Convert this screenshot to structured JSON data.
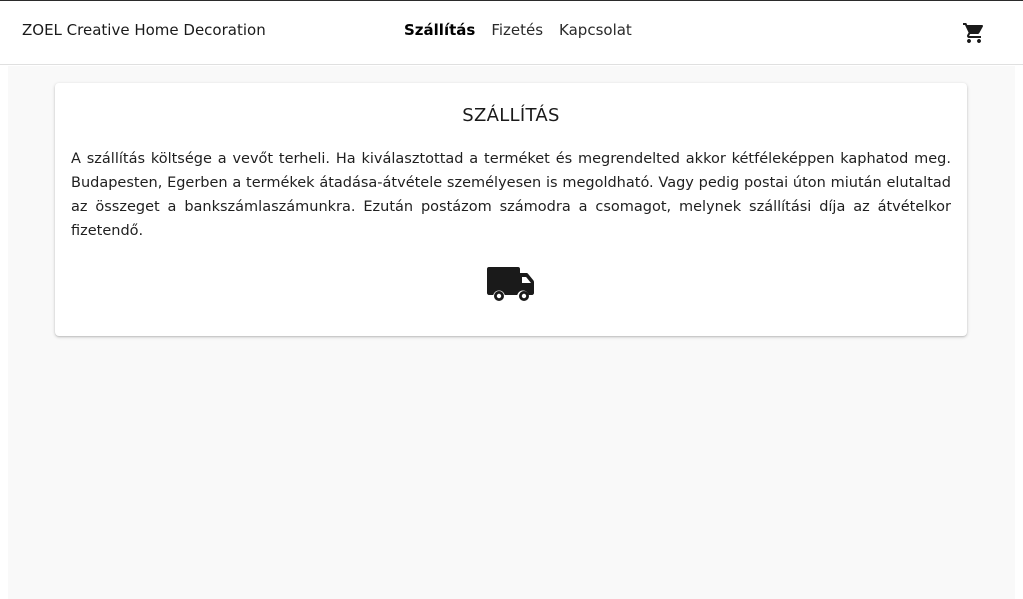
{
  "header": {
    "brand": "ZOEL Creative Home Decoration",
    "nav": [
      {
        "label": "Szállítás",
        "active": true
      },
      {
        "label": "Fizetés",
        "active": false
      },
      {
        "label": "Kapcsolat",
        "active": false
      }
    ],
    "cart_icon": "shopping-cart-icon"
  },
  "card": {
    "title": "SZÁLLÍTÁS",
    "text": "A szállítás költsége a vevőt terheli. Ha kiválasztottad a terméket és megrendelted akkor kétféleképpen kaphatod meg. Budapesten, Egerben a termékek átadása-átvétele személyesen is megoldható. Vagy pedig postai úton miután elutaltad az összeget a bankszámlaszámunkra. Ezután postázom számodra a csomagot, melynek szállítási díja az átvételkor fizetendő.",
    "icon": "truck-icon"
  },
  "colors": {
    "page_background": "#f9f9f9",
    "card_background": "#ffffff",
    "text": "#1a1a1a",
    "icon": "#1a1a1a"
  }
}
